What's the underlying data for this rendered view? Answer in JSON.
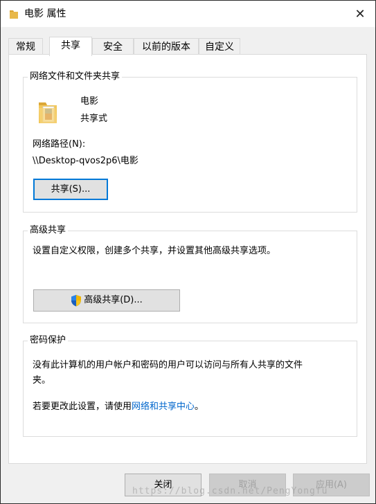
{
  "window": {
    "title": "电影 属性",
    "close_symbol": "✕"
  },
  "tabs": [
    {
      "label": "常规"
    },
    {
      "label": "共享",
      "active": true
    },
    {
      "label": "安全"
    },
    {
      "label": "以前的版本"
    },
    {
      "label": "自定义"
    }
  ],
  "network_sharing": {
    "title": "网络文件和文件夹共享",
    "folder_name": "电影",
    "share_status": "共享式",
    "network_path_label": "网络路径(N):",
    "network_path_value": "\\\\Desktop-qvos2p6\\电影",
    "share_button": "共享(S)..."
  },
  "advanced_sharing": {
    "title": "高级共享",
    "description": "设置自定义权限，创建多个共享，并设置其他高级共享选项。",
    "button": "高级共享(D)..."
  },
  "password_protection": {
    "title": "密码保护",
    "description_line1": "没有此计算机的用户帐户和密码的用户可以访问与所有人共享的文件",
    "description_line2": "夹。",
    "change_prefix": "若要更改此设置，请使用",
    "change_link": "网络和共享中心",
    "change_suffix": "。"
  },
  "footer": {
    "close_button": "关闭",
    "cancel_button": "取消",
    "apply_button": "应用(A)",
    "watermark": "https://blog.csdn.net/PengYongfu"
  },
  "colors": {
    "accent": "#0078d7",
    "link": "#0066cc",
    "window_background": "#f0f0f0"
  }
}
